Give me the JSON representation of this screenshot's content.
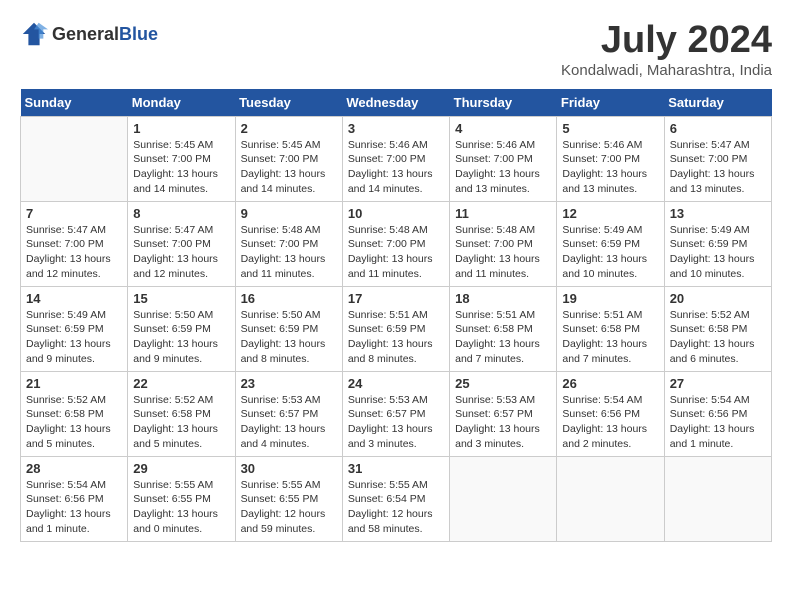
{
  "header": {
    "logo_general": "General",
    "logo_blue": "Blue",
    "title": "July 2024",
    "location": "Kondalwadi, Maharashtra, India"
  },
  "weekdays": [
    "Sunday",
    "Monday",
    "Tuesday",
    "Wednesday",
    "Thursday",
    "Friday",
    "Saturday"
  ],
  "weeks": [
    [
      {
        "day": "",
        "sunrise": "",
        "sunset": "",
        "daylight": ""
      },
      {
        "day": "1",
        "sunrise": "Sunrise: 5:45 AM",
        "sunset": "Sunset: 7:00 PM",
        "daylight": "Daylight: 13 hours and 14 minutes."
      },
      {
        "day": "2",
        "sunrise": "Sunrise: 5:45 AM",
        "sunset": "Sunset: 7:00 PM",
        "daylight": "Daylight: 13 hours and 14 minutes."
      },
      {
        "day": "3",
        "sunrise": "Sunrise: 5:46 AM",
        "sunset": "Sunset: 7:00 PM",
        "daylight": "Daylight: 13 hours and 14 minutes."
      },
      {
        "day": "4",
        "sunrise": "Sunrise: 5:46 AM",
        "sunset": "Sunset: 7:00 PM",
        "daylight": "Daylight: 13 hours and 13 minutes."
      },
      {
        "day": "5",
        "sunrise": "Sunrise: 5:46 AM",
        "sunset": "Sunset: 7:00 PM",
        "daylight": "Daylight: 13 hours and 13 minutes."
      },
      {
        "day": "6",
        "sunrise": "Sunrise: 5:47 AM",
        "sunset": "Sunset: 7:00 PM",
        "daylight": "Daylight: 13 hours and 13 minutes."
      }
    ],
    [
      {
        "day": "7",
        "sunrise": "Sunrise: 5:47 AM",
        "sunset": "Sunset: 7:00 PM",
        "daylight": "Daylight: 13 hours and 12 minutes."
      },
      {
        "day": "8",
        "sunrise": "Sunrise: 5:47 AM",
        "sunset": "Sunset: 7:00 PM",
        "daylight": "Daylight: 13 hours and 12 minutes."
      },
      {
        "day": "9",
        "sunrise": "Sunrise: 5:48 AM",
        "sunset": "Sunset: 7:00 PM",
        "daylight": "Daylight: 13 hours and 11 minutes."
      },
      {
        "day": "10",
        "sunrise": "Sunrise: 5:48 AM",
        "sunset": "Sunset: 7:00 PM",
        "daylight": "Daylight: 13 hours and 11 minutes."
      },
      {
        "day": "11",
        "sunrise": "Sunrise: 5:48 AM",
        "sunset": "Sunset: 7:00 PM",
        "daylight": "Daylight: 13 hours and 11 minutes."
      },
      {
        "day": "12",
        "sunrise": "Sunrise: 5:49 AM",
        "sunset": "Sunset: 6:59 PM",
        "daylight": "Daylight: 13 hours and 10 minutes."
      },
      {
        "day": "13",
        "sunrise": "Sunrise: 5:49 AM",
        "sunset": "Sunset: 6:59 PM",
        "daylight": "Daylight: 13 hours and 10 minutes."
      }
    ],
    [
      {
        "day": "14",
        "sunrise": "Sunrise: 5:49 AM",
        "sunset": "Sunset: 6:59 PM",
        "daylight": "Daylight: 13 hours and 9 minutes."
      },
      {
        "day": "15",
        "sunrise": "Sunrise: 5:50 AM",
        "sunset": "Sunset: 6:59 PM",
        "daylight": "Daylight: 13 hours and 9 minutes."
      },
      {
        "day": "16",
        "sunrise": "Sunrise: 5:50 AM",
        "sunset": "Sunset: 6:59 PM",
        "daylight": "Daylight: 13 hours and 8 minutes."
      },
      {
        "day": "17",
        "sunrise": "Sunrise: 5:51 AM",
        "sunset": "Sunset: 6:59 PM",
        "daylight": "Daylight: 13 hours and 8 minutes."
      },
      {
        "day": "18",
        "sunrise": "Sunrise: 5:51 AM",
        "sunset": "Sunset: 6:58 PM",
        "daylight": "Daylight: 13 hours and 7 minutes."
      },
      {
        "day": "19",
        "sunrise": "Sunrise: 5:51 AM",
        "sunset": "Sunset: 6:58 PM",
        "daylight": "Daylight: 13 hours and 7 minutes."
      },
      {
        "day": "20",
        "sunrise": "Sunrise: 5:52 AM",
        "sunset": "Sunset: 6:58 PM",
        "daylight": "Daylight: 13 hours and 6 minutes."
      }
    ],
    [
      {
        "day": "21",
        "sunrise": "Sunrise: 5:52 AM",
        "sunset": "Sunset: 6:58 PM",
        "daylight": "Daylight: 13 hours and 5 minutes."
      },
      {
        "day": "22",
        "sunrise": "Sunrise: 5:52 AM",
        "sunset": "Sunset: 6:58 PM",
        "daylight": "Daylight: 13 hours and 5 minutes."
      },
      {
        "day": "23",
        "sunrise": "Sunrise: 5:53 AM",
        "sunset": "Sunset: 6:57 PM",
        "daylight": "Daylight: 13 hours and 4 minutes."
      },
      {
        "day": "24",
        "sunrise": "Sunrise: 5:53 AM",
        "sunset": "Sunset: 6:57 PM",
        "daylight": "Daylight: 13 hours and 3 minutes."
      },
      {
        "day": "25",
        "sunrise": "Sunrise: 5:53 AM",
        "sunset": "Sunset: 6:57 PM",
        "daylight": "Daylight: 13 hours and 3 minutes."
      },
      {
        "day": "26",
        "sunrise": "Sunrise: 5:54 AM",
        "sunset": "Sunset: 6:56 PM",
        "daylight": "Daylight: 13 hours and 2 minutes."
      },
      {
        "day": "27",
        "sunrise": "Sunrise: 5:54 AM",
        "sunset": "Sunset: 6:56 PM",
        "daylight": "Daylight: 13 hours and 1 minute."
      }
    ],
    [
      {
        "day": "28",
        "sunrise": "Sunrise: 5:54 AM",
        "sunset": "Sunset: 6:56 PM",
        "daylight": "Daylight: 13 hours and 1 minute."
      },
      {
        "day": "29",
        "sunrise": "Sunrise: 5:55 AM",
        "sunset": "Sunset: 6:55 PM",
        "daylight": "Daylight: 13 hours and 0 minutes."
      },
      {
        "day": "30",
        "sunrise": "Sunrise: 5:55 AM",
        "sunset": "Sunset: 6:55 PM",
        "daylight": "Daylight: 12 hours and 59 minutes."
      },
      {
        "day": "31",
        "sunrise": "Sunrise: 5:55 AM",
        "sunset": "Sunset: 6:54 PM",
        "daylight": "Daylight: 12 hours and 58 minutes."
      },
      {
        "day": "",
        "sunrise": "",
        "sunset": "",
        "daylight": ""
      },
      {
        "day": "",
        "sunrise": "",
        "sunset": "",
        "daylight": ""
      },
      {
        "day": "",
        "sunrise": "",
        "sunset": "",
        "daylight": ""
      }
    ]
  ]
}
